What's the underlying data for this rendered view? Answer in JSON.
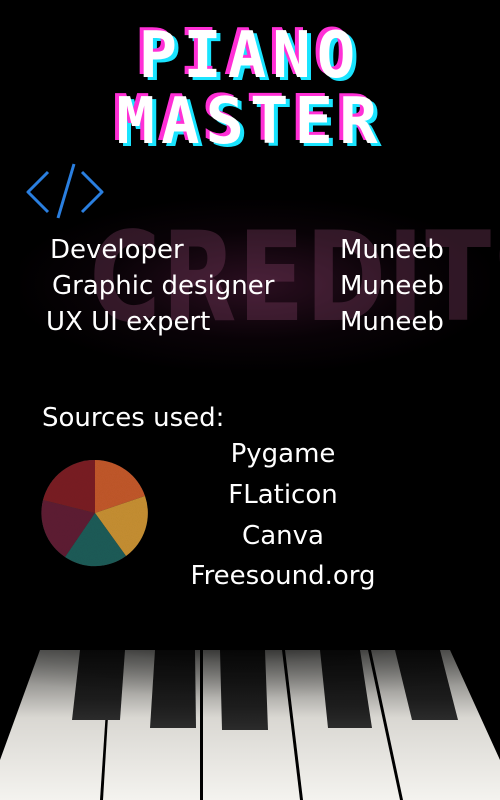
{
  "title": {
    "line1": "PIANO",
    "line2": "MASTER"
  },
  "watermark": "CREDITS",
  "credits": [
    {
      "role": "Developer",
      "name": "Muneeb"
    },
    {
      "role": "Graphic designer",
      "name": "Muneeb"
    },
    {
      "role": "UX UI expert",
      "name": "Muneeb"
    }
  ],
  "sources": {
    "heading": "Sources used:",
    "items": [
      "Pygame",
      "FLaticon",
      "Canva",
      "Freesound.org"
    ]
  },
  "icons": {
    "code": "code-brackets-icon",
    "pie": "pie-chart-icon"
  },
  "colors": {
    "background": "#000000",
    "title_pink": "#ff2fd6",
    "title_cyan": "#19e4ff",
    "code_icon": "#2a7fe0",
    "pie": [
      "#c2582a",
      "#c79032",
      "#1e5c58",
      "#5e1d33",
      "#7a1d22"
    ]
  }
}
